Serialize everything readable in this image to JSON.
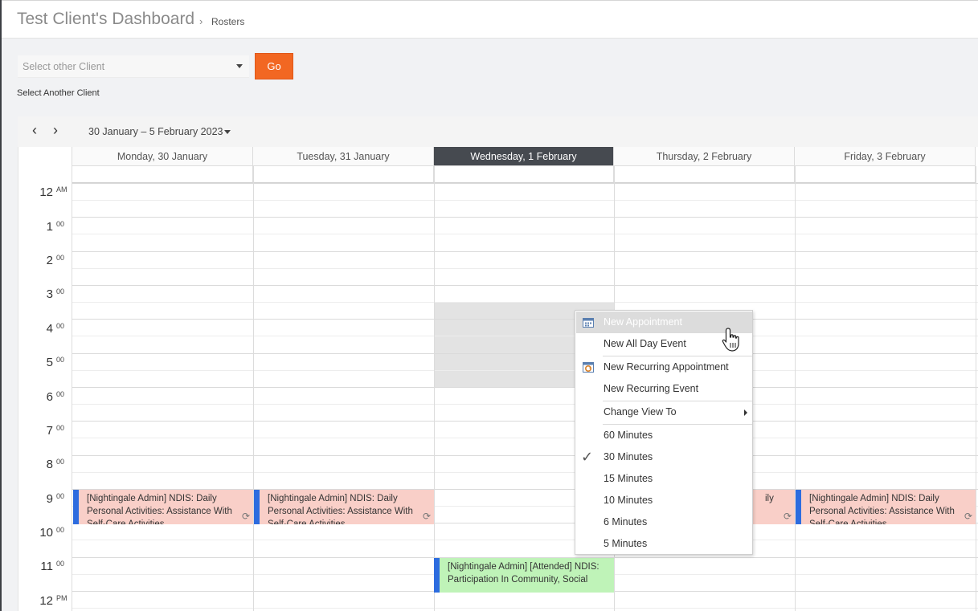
{
  "header": {
    "title": "Test Client's Dashboard",
    "separator": "›",
    "breadcrumb": "Rosters"
  },
  "client_picker": {
    "placeholder": "Select other Client",
    "go_label": "Go",
    "help_label": "Select Another Client"
  },
  "toolbar": {
    "prev_icon": "‹",
    "next_icon": "›",
    "range_label": "30 January – 5 February 2023"
  },
  "days": [
    {
      "label": "Monday, 30 January",
      "today": false
    },
    {
      "label": "Tuesday, 31 January",
      "today": false
    },
    {
      "label": "Wednesday, 1 February",
      "today": true
    },
    {
      "label": "Thursday, 2 February",
      "today": false
    },
    {
      "label": "Friday, 3 February",
      "today": false
    }
  ],
  "hours": [
    {
      "h": "12",
      "m": "AM"
    },
    {
      "h": "1",
      "m": "00"
    },
    {
      "h": "2",
      "m": "00"
    },
    {
      "h": "3",
      "m": "00"
    },
    {
      "h": "4",
      "m": "00"
    },
    {
      "h": "5",
      "m": "00"
    },
    {
      "h": "6",
      "m": "00"
    },
    {
      "h": "7",
      "m": "00"
    },
    {
      "h": "8",
      "m": "00"
    },
    {
      "h": "9",
      "m": "00"
    },
    {
      "h": "10",
      "m": "00"
    },
    {
      "h": "11",
      "m": "00"
    },
    {
      "h": "12",
      "m": "PM"
    }
  ],
  "appointments": [
    {
      "day": "Monday",
      "text": "[Nightingale Admin] NDIS: Daily Personal Activities: Assistance With Self-Care Activities",
      "recurring": true,
      "color": "#f9cfc8"
    },
    {
      "day": "Tuesday",
      "text": "[Nightingale Admin] NDIS: Daily Personal Activities: Assistance With Self-Care Activities",
      "recurring": true,
      "color": "#f9cfc8"
    },
    {
      "day": "Thursday",
      "text": "ily",
      "recurring": true,
      "color": "#f9cfc8"
    },
    {
      "day": "Friday",
      "text": "[Nightingale Admin] NDIS: Daily Personal Activities: Assistance With Self-Care Activities",
      "recurring": true,
      "color": "#f9cfc8"
    },
    {
      "day": "Wednesday",
      "text": "[Nightingale Admin] [Attended] NDIS: Participation In Community, Social",
      "recurring": false,
      "color": "#bff3b8"
    }
  ],
  "context_menu": {
    "items": [
      {
        "label": "New Appointment",
        "icon": "calendar-icon",
        "highlighted": true
      },
      {
        "label": "New All Day Event"
      },
      {
        "label": "New Recurring Appointment",
        "icon": "recurring-icon"
      },
      {
        "label": "New Recurring Event"
      },
      {
        "label": "Change View To",
        "submenu": true
      },
      {
        "label": "60 Minutes"
      },
      {
        "label": "30 Minutes",
        "checked": true
      },
      {
        "label": "15 Minutes"
      },
      {
        "label": "10 Minutes"
      },
      {
        "label": "6 Minutes"
      },
      {
        "label": "5 Minutes"
      }
    ]
  },
  "colors": {
    "accent": "#f26722",
    "today_header": "#464a50",
    "appointment_bar": "#2d6cdf"
  }
}
